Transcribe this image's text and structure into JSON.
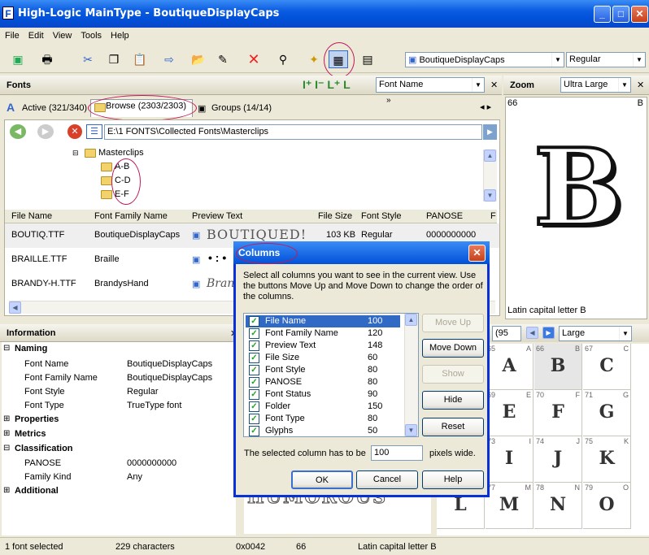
{
  "window": {
    "title": "High-Logic MainType - BoutiqueDisplayCaps",
    "app_icon": "F"
  },
  "menu": [
    "File",
    "Edit",
    "View",
    "Tools",
    "Help"
  ],
  "toolbar": {
    "font_combo": "BoutiqueDisplayCaps",
    "style_combo": "Regular",
    "overflow": "»"
  },
  "fonts_panel": {
    "title": "Fonts",
    "sort_combo": "Font Name",
    "tabs": {
      "active": "Active (321/340)",
      "browse": "Browse (2303/2303)",
      "groups": "Groups (14/14)"
    },
    "path": "E:\\1 FONTS\\Collected Fonts\\Masterclips",
    "tree": {
      "parent": "Masterclips",
      "children": [
        "A-B",
        "C-D",
        "E-F"
      ]
    },
    "columns": [
      "File Name",
      "Font Family Name",
      "Preview Text",
      "File Size",
      "Font Style",
      "PANOSE",
      "F"
    ],
    "rows": [
      {
        "file": "BOUTIQ.TTF",
        "family": "BoutiqueDisplayCaps",
        "preview": "BOUTIQUED!",
        "size": "103 KB",
        "style": "Regular",
        "panose": "0000000000"
      },
      {
        "file": "BRAILLE.TTF",
        "family": "Braille",
        "preview": "• : •",
        "size": "",
        "style": "",
        "panose": ""
      },
      {
        "file": "BRANDY-H.TTF",
        "family": "BrandysHand",
        "preview": "Brand",
        "size": "",
        "style": "",
        "panose": ""
      }
    ]
  },
  "info_panel": {
    "title": "Information",
    "sections": {
      "naming": "Naming",
      "properties": "Properties",
      "metrics": "Metrics",
      "classification": "Classification",
      "additional": "Additional"
    },
    "naming_rows": [
      {
        "k": "Font Name",
        "v": "BoutiqueDisplayCaps"
      },
      {
        "k": "Font Family Name",
        "v": "BoutiqueDisplayCaps"
      },
      {
        "k": "Font Style",
        "v": "Regular"
      },
      {
        "k": "Font Type",
        "v": "TrueType font"
      }
    ],
    "classification_rows": [
      {
        "k": "PANOSE",
        "v": "0000000000"
      },
      {
        "k": "Family Kind",
        "v": "Any"
      }
    ]
  },
  "zoom_panel": {
    "title": "Zoom",
    "size": "Ultra Large",
    "code": "66",
    "letter": "B",
    "glyph": "B",
    "caption": "Latin capital letter B"
  },
  "charmap": {
    "range_combo": "(95",
    "size_combo": "Large",
    "cells": [
      {
        "n": "",
        "l": "",
        "g": ""
      },
      {
        "n": "65",
        "l": "A",
        "g": "A"
      },
      {
        "n": "66",
        "l": "B",
        "g": "B"
      },
      {
        "n": "67",
        "l": "C",
        "g": "C"
      },
      {
        "n": "",
        "l": "",
        "g": ""
      },
      {
        "n": "69",
        "l": "E",
        "g": "E"
      },
      {
        "n": "70",
        "l": "F",
        "g": "F"
      },
      {
        "n": "71",
        "l": "G",
        "g": "G"
      },
      {
        "n": "",
        "l": "",
        "g": ""
      },
      {
        "n": "73",
        "l": "I",
        "g": "I"
      },
      {
        "n": "74",
        "l": "J",
        "g": "J"
      },
      {
        "n": "75",
        "l": "K",
        "g": "K"
      },
      {
        "n": "",
        "l": "",
        "g": "L"
      },
      {
        "n": "77",
        "l": "M",
        "g": "M"
      },
      {
        "n": "78",
        "l": "N",
        "g": "N"
      },
      {
        "n": "79",
        "l": "O",
        "g": "O"
      }
    ]
  },
  "preview_bg_text": "HUMOROUS",
  "dialog": {
    "title": "Columns",
    "instructions": "Select all columns you want to see in the current view. Use the buttons Move Up and Move Down to change the order of the columns.",
    "items": [
      {
        "name": "File Name",
        "width": "100"
      },
      {
        "name": "Font Family Name",
        "width": "120"
      },
      {
        "name": "Preview Text",
        "width": "148"
      },
      {
        "name": "File Size",
        "width": "60"
      },
      {
        "name": "Font Style",
        "width": "80"
      },
      {
        "name": "PANOSE",
        "width": "80"
      },
      {
        "name": "Font Status",
        "width": "90"
      },
      {
        "name": "Folder",
        "width": "150"
      },
      {
        "name": "Font Type",
        "width": "80"
      },
      {
        "name": "Glyphs",
        "width": "50"
      }
    ],
    "buttons": {
      "move_up": "Move Up",
      "move_down": "Move Down",
      "show": "Show",
      "hide": "Hide",
      "reset": "Reset",
      "ok": "OK",
      "cancel": "Cancel",
      "help": "Help"
    },
    "width_label": "The selected column has to be",
    "width_value": "100",
    "width_unit": "pixels wide."
  },
  "status": {
    "selected": "1 font selected",
    "chars": "229 characters",
    "hex": "0x0042",
    "dec": "66",
    "name": "Latin capital letter B"
  },
  "colors": {
    "accent": "#0050D8",
    "highlight": "#C2185B",
    "selection": "#316AC5"
  }
}
